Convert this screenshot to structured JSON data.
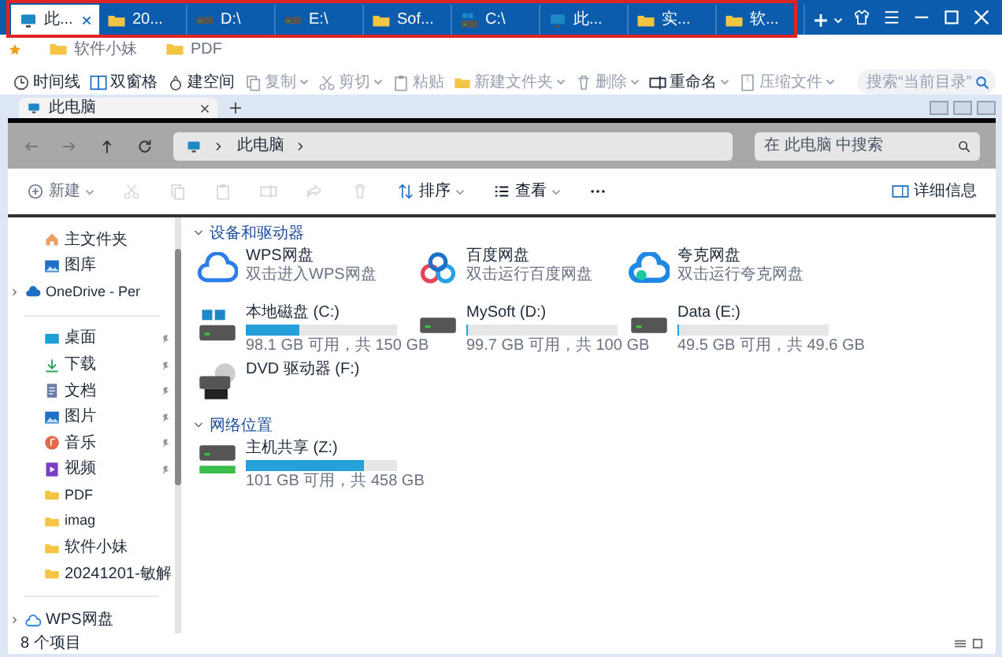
{
  "top_tabs": [
    {
      "label": "此...",
      "kind": "pc",
      "selected": true
    },
    {
      "label": "20...",
      "kind": "folder",
      "selected": false
    },
    {
      "label": "D:\\",
      "kind": "drive",
      "selected": false
    },
    {
      "label": "E:\\",
      "kind": "drive",
      "selected": false
    },
    {
      "label": "Sof...",
      "kind": "folder",
      "selected": false
    },
    {
      "label": "C:\\",
      "kind": "sysdrive",
      "selected": false
    },
    {
      "label": "此...",
      "kind": "pc",
      "selected": false
    },
    {
      "label": "实...",
      "kind": "folder",
      "selected": false
    },
    {
      "label": "软...",
      "kind": "folder",
      "selected": false
    }
  ],
  "bookmarks": [
    {
      "label": "软件小妹"
    },
    {
      "label": "PDF"
    }
  ],
  "toolbar": [
    {
      "label": "时间线",
      "kind": "clock",
      "disabled": false,
      "menu": false
    },
    {
      "label": "双窗格",
      "kind": "panes",
      "disabled": false,
      "menu": false
    },
    {
      "label": "建空间",
      "kind": "bag",
      "disabled": false,
      "menu": false
    },
    {
      "label": "复制",
      "kind": "copy",
      "disabled": true,
      "menu": true
    },
    {
      "label": "剪切",
      "kind": "cut",
      "disabled": true,
      "menu": true
    },
    {
      "label": "粘贴",
      "kind": "paste",
      "disabled": true,
      "menu": false
    },
    {
      "label": "新建文件夹",
      "kind": "folder",
      "disabled": true,
      "menu": true
    },
    {
      "label": "删除",
      "kind": "trash",
      "disabled": true,
      "menu": true
    },
    {
      "label": "重命名",
      "kind": "rename",
      "disabled": false,
      "menu": true
    },
    {
      "label": "压缩文件",
      "kind": "zip",
      "disabled": true,
      "menu": true
    }
  ],
  "toolbar_search": {
    "placeholder": "搜索“当前目录”"
  },
  "explorer": {
    "tab": {
      "label": "此电脑"
    },
    "address": {
      "segments": [
        "此电脑"
      ]
    },
    "search": {
      "placeholder": "在 此电脑 中搜索"
    },
    "commands": [
      {
        "label": "新建",
        "kind": "plus",
        "disabled": true,
        "menu": true
      },
      {
        "kind": "cut",
        "disabled": true
      },
      {
        "kind": "copy",
        "disabled": true
      },
      {
        "kind": "paste",
        "disabled": true
      },
      {
        "kind": "rename",
        "disabled": true
      },
      {
        "kind": "share",
        "disabled": true
      },
      {
        "kind": "trash",
        "disabled": true
      },
      {
        "label": "排序",
        "kind": "sort",
        "disabled": false,
        "menu": true
      },
      {
        "label": "查看",
        "kind": "view",
        "disabled": false,
        "menu": true
      },
      {
        "kind": "more",
        "disabled": false
      }
    ],
    "details": "详细信息"
  },
  "sidebar": [
    {
      "label": "主文件夹",
      "kind": "home",
      "pinned": false,
      "group_start": false
    },
    {
      "label": "图库",
      "kind": "gallery",
      "pinned": false,
      "group_start": false
    },
    {
      "label": "OneDrive - Per",
      "kind": "cloud",
      "pinned": false,
      "expanded": false,
      "group_start": false
    },
    {
      "label": "桌面",
      "kind": "desktop",
      "pinned": true,
      "group_start": true
    },
    {
      "label": "下载",
      "kind": "download",
      "pinned": true,
      "group_start": false
    },
    {
      "label": "文档",
      "kind": "doc",
      "pinned": true,
      "group_start": false
    },
    {
      "label": "图片",
      "kind": "gallery",
      "pinned": true,
      "group_start": false
    },
    {
      "label": "音乐",
      "kind": "music",
      "pinned": true,
      "group_start": false
    },
    {
      "label": "视频",
      "kind": "video",
      "pinned": true,
      "group_start": false
    },
    {
      "label": "PDF",
      "kind": "folder",
      "pinned": false,
      "group_start": false
    },
    {
      "label": "imag",
      "kind": "folder",
      "pinned": false,
      "group_start": false
    },
    {
      "label": "软件小妹",
      "kind": "folder",
      "pinned": false,
      "group_start": false
    },
    {
      "label": "20241201-敏解",
      "kind": "folder",
      "pinned": false,
      "group_start": false
    },
    {
      "label": "WPS网盘",
      "kind": "wps",
      "pinned": false,
      "expanded": false,
      "group_start": true
    }
  ],
  "sections": [
    {
      "title": "设备和驱动器",
      "expanded": true,
      "items": [
        {
          "kind": "wps",
          "name": "WPS网盘",
          "subtitle": "双击进入WPS网盘"
        },
        {
          "kind": "baidu",
          "name": "百度网盘",
          "subtitle": "双击运行百度网盘"
        },
        {
          "kind": "quark",
          "name": "夸克网盘",
          "subtitle": "双击运行夸克网盘"
        },
        {
          "kind": "sysdrive",
          "name": "本地磁盘 (C:)",
          "level": 0.35,
          "reading": "98.1 GB 可用，共 150 GB"
        },
        {
          "kind": "drive",
          "name": "MySoft (D:)",
          "level": 0.003,
          "reading": "99.7 GB 可用，共 100 GB"
        },
        {
          "kind": "drive",
          "name": "Data (E:)",
          "level": 0.002,
          "reading": "49.5 GB 可用，共 49.6 GB"
        },
        {
          "kind": "dvd",
          "name": "DVD 驱动器 (F:)"
        }
      ]
    },
    {
      "title": "网络位置",
      "expanded": true,
      "items": [
        {
          "kind": "netdrive",
          "name": "主机共享 (Z:)",
          "level": 0.78,
          "reading": "101 GB 可用，共 458 GB"
        }
      ]
    }
  ],
  "status_bar": "8 个项目"
}
